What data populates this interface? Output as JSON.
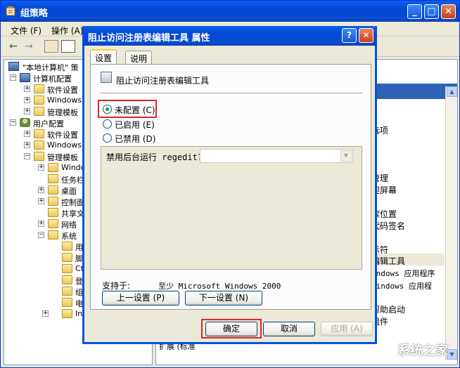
{
  "main": {
    "title": "组策略",
    "menu": [
      "文件 (F)",
      "操作 (A)"
    ],
    "tree": {
      "root": "\"本地计算机\" 策",
      "computer": "计算机配置",
      "computer_items": [
        "软件设置",
        "Windows",
        "管理模板"
      ],
      "user": "用户配置",
      "user_items": [
        "软件设置",
        "Windows",
        "管理模板"
      ],
      "admin_items": [
        "Windo",
        "任务栏",
        "桌面",
        "控制面",
        "共享文",
        "网络",
        "系统"
      ],
      "system_items": [
        "用",
        "脚",
        "Ct",
        "登",
        "组",
        "电",
        "In"
      ]
    },
    "right_items": [
      "选项",
      "管理",
      "迎屏幕",
      "索位置",
      "代码签名",
      "示符",
      "编辑工具",
      "indows 应用程序",
      "Windows 应用程",
      "帮助启动",
      "组件"
    ],
    "bottom_tabs": "扩展 (标准"
  },
  "dialog": {
    "title": "阻止访问注册表编辑工具 属性",
    "help_label": "?",
    "close_label": "✕",
    "tabs": [
      "设置",
      "说明"
    ],
    "policy_name": "阻止访问注册表编辑工具",
    "radios": [
      {
        "label": "未配置 (C)",
        "checked": true
      },
      {
        "label": "已启用 (E)",
        "checked": false
      },
      {
        "label": "已禁用 (D)",
        "checked": false
      }
    ],
    "option_label": "禁用后台运行 regedit?",
    "supported_label": "支持于:",
    "supported_value": "至少 Microsoft Windows 2000",
    "prev_button": "上一设置 (P)",
    "next_button": "下一设置 (N)",
    "ok_button": "确定",
    "cancel_button": "取消",
    "apply_button": "应用 (A)"
  },
  "watermark": "系统之家",
  "colors": {
    "titlebar": "#0A5FE8",
    "highlight_box": "#E0262A",
    "dialog_bg": "#ECE9D8"
  }
}
